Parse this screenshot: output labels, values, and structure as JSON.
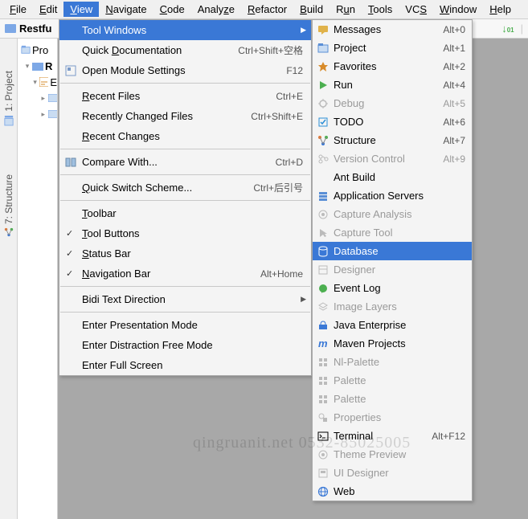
{
  "menubar": {
    "items": [
      {
        "label": "File",
        "mn": "F"
      },
      {
        "label": "Edit",
        "mn": "E"
      },
      {
        "label": "View",
        "mn": "V"
      },
      {
        "label": "Navigate",
        "mn": "N"
      },
      {
        "label": "Code",
        "mn": "C"
      },
      {
        "label": "Analyze",
        "mn": "z"
      },
      {
        "label": "Refactor",
        "mn": "R"
      },
      {
        "label": "Build",
        "mn": "B"
      },
      {
        "label": "Run",
        "mn": "u"
      },
      {
        "label": "Tools",
        "mn": "T"
      },
      {
        "label": "VCS",
        "mn": "S"
      },
      {
        "label": "Window",
        "mn": "W"
      },
      {
        "label": "Help",
        "mn": "H"
      }
    ]
  },
  "toolbar": {
    "project_name": "Restfu"
  },
  "left_gutter": {
    "project": "1: Project",
    "structure": "7: Structure"
  },
  "project_pane": {
    "tab": "Pro",
    "root": "R",
    "ext": "E"
  },
  "view_menu": {
    "tool_windows": "Tool Windows",
    "quick_doc": {
      "label": "Quick Documentation",
      "shortcut": "Ctrl+Shift+空格",
      "mn": "D"
    },
    "open_module": {
      "label": "Open Module Settings",
      "shortcut": "F12"
    },
    "recent_files": {
      "label": "Recent Files",
      "shortcut": "Ctrl+E",
      "mn": "R"
    },
    "recent_changed": {
      "label": "Recently Changed Files",
      "shortcut": "Ctrl+Shift+E"
    },
    "recent_changes": {
      "label": "Recent Changes",
      "mn": "R"
    },
    "compare": {
      "label": "Compare With...",
      "shortcut": "Ctrl+D"
    },
    "quick_switch": {
      "label": "Quick Switch Scheme...",
      "shortcut": "Ctrl+后引号",
      "mn": "Q"
    },
    "toolbar_item": {
      "label": "Toolbar",
      "mn": "T"
    },
    "tool_buttons": {
      "label": "Tool Buttons",
      "mn": "T"
    },
    "status_bar": {
      "label": "Status Bar",
      "mn": "S"
    },
    "nav_bar": {
      "label": "Navigation Bar",
      "shortcut": "Alt+Home",
      "mn": "N"
    },
    "bidi": {
      "label": "Bidi Text Direction"
    },
    "pres_mode": {
      "label": "Enter Presentation Mode"
    },
    "dist_free": {
      "label": "Enter Distraction Free Mode"
    },
    "full_screen": {
      "label": "Enter Full Screen"
    }
  },
  "tool_windows": {
    "items": [
      {
        "label": "Messages",
        "shortcut": "Alt+0",
        "icon": "messages",
        "color": "#e0b24a"
      },
      {
        "label": "Project",
        "shortcut": "Alt+1",
        "icon": "project",
        "color": "#5a8fd6"
      },
      {
        "label": "Favorites",
        "shortcut": "Alt+2",
        "icon": "star",
        "color": "#d88b2a"
      },
      {
        "label": "Run",
        "shortcut": "Alt+4",
        "icon": "run",
        "color": "#4caf50"
      },
      {
        "label": "Debug",
        "shortcut": "Alt+5",
        "icon": "debug",
        "disabled": true
      },
      {
        "label": "TODO",
        "shortcut": "Alt+6",
        "icon": "todo",
        "color": "#2a8ed6"
      },
      {
        "label": "Structure",
        "shortcut": "Alt+7",
        "icon": "structure",
        "color": "#e07a3a"
      },
      {
        "label": "Version Control",
        "shortcut": "Alt+9",
        "icon": "vcs",
        "disabled": true
      },
      {
        "label": "Ant Build",
        "icon": "ant",
        "color": "#000"
      },
      {
        "label": "Application Servers",
        "icon": "servers",
        "color": "#5a8fd6"
      },
      {
        "label": "Capture Analysis",
        "icon": "capture",
        "disabled": true
      },
      {
        "label": "Capture Tool",
        "icon": "capturetool",
        "disabled": true
      },
      {
        "label": "Database",
        "icon": "db",
        "highlight": true
      },
      {
        "label": "Designer",
        "icon": "designer",
        "disabled": true
      },
      {
        "label": "Event Log",
        "icon": "eventlog",
        "color": "#4caf50"
      },
      {
        "label": "Image Layers",
        "icon": "layers",
        "disabled": true
      },
      {
        "label": "Java Enterprise",
        "icon": "javaee",
        "color": "#3a78d6"
      },
      {
        "label": "Maven Projects",
        "icon": "maven",
        "color": "#3a78d6",
        "ital": true
      },
      {
        "label": "Nl-Palette",
        "icon": "nlpalette",
        "disabled": true
      },
      {
        "label": "Palette",
        "icon": "palette1",
        "disabled": true
      },
      {
        "label": "Palette",
        "icon": "palette2",
        "disabled": true
      },
      {
        "label": "Properties",
        "icon": "properties",
        "disabled": true
      },
      {
        "label": "Terminal",
        "shortcut": "Alt+F12",
        "icon": "terminal",
        "color": "#000"
      },
      {
        "label": "Theme Preview",
        "icon": "theme",
        "disabled": true
      },
      {
        "label": "UI Designer",
        "icon": "uidesigner",
        "disabled": true
      },
      {
        "label": "Web",
        "icon": "web",
        "color": "#3a78d6"
      }
    ]
  },
  "watermark": "qingruanit.net 0532-85025005"
}
